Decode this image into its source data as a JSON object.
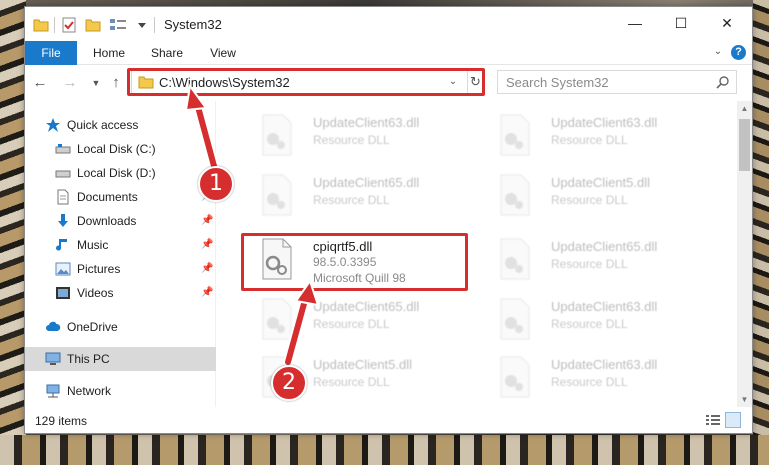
{
  "titlebar": {
    "title": "System32",
    "controls": {
      "minimize": "—",
      "maximize": "☐",
      "close": "✕"
    }
  },
  "ribbon": {
    "tabs": [
      {
        "label": "File"
      },
      {
        "label": "Home"
      },
      {
        "label": "Share"
      },
      {
        "label": "View"
      }
    ],
    "help": "?"
  },
  "navigation": {
    "back": "←",
    "forward": "→",
    "up": "↑",
    "address": "C:\\Windows\\System32",
    "refresh": "↻",
    "search_placeholder": "Search System32"
  },
  "sidebar": {
    "items": [
      {
        "label": "Quick access",
        "icon": "star-icon"
      },
      {
        "label": "Local Disk (C:)",
        "icon": "drive-icon"
      },
      {
        "label": "Local Disk (D:)",
        "icon": "drive-icon"
      },
      {
        "label": "Documents",
        "icon": "document-icon"
      },
      {
        "label": "Downloads",
        "icon": "download-icon"
      },
      {
        "label": "Music",
        "icon": "music-icon"
      },
      {
        "label": "Pictures",
        "icon": "picture-icon"
      },
      {
        "label": "Videos",
        "icon": "video-icon"
      },
      {
        "label": "OneDrive",
        "icon": "cloud-icon"
      },
      {
        "label": "This PC",
        "icon": "computer-icon"
      },
      {
        "label": "Network",
        "icon": "network-icon"
      }
    ]
  },
  "files": [
    {
      "name": "UpdateClient63.dll",
      "desc": "Resource DLL"
    },
    {
      "name": "UpdateClient63.dll",
      "desc": "Resource DLL"
    },
    {
      "name": "UpdateClient65.dll",
      "desc": "Resource DLL"
    },
    {
      "name": "UpdateClient5.dll",
      "desc": "Resource DLL"
    },
    {
      "name": "cpiqrtf5.dll",
      "version": "98.5.0.3395",
      "desc": "Microsoft Quill 98"
    },
    {
      "name": "UpdateClient65.dll",
      "desc": "Resource DLL"
    },
    {
      "name": "UpdateClient65.dll",
      "desc": "Resource DLL"
    },
    {
      "name": "UpdateClient63.dll",
      "desc": "Resource DLL"
    },
    {
      "name": "UpdateClient5.dll",
      "desc": "Resource DLL"
    },
    {
      "name": "UpdateClient63.dll",
      "desc": "Resource DLL"
    }
  ],
  "status": {
    "count": "129 items"
  },
  "markers": {
    "one": "1",
    "two": "2"
  },
  "colors": {
    "accent": "#1979ca",
    "highlight": "#d62e2e",
    "selected": "#cce8ff"
  }
}
